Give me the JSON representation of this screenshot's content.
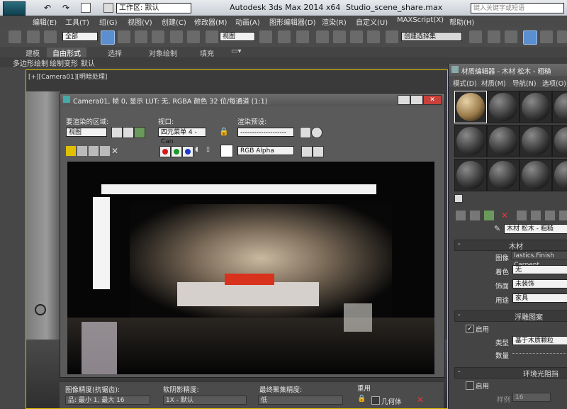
{
  "app": {
    "title": "Autodesk 3ds Max  2014 x64",
    "file": "Studio_scene_share.max",
    "workspace_label": "工作区: 默认",
    "search_placeholder": "键入关键字或短语"
  },
  "menu": [
    "编辑(E)",
    "工具(T)",
    "组(G)",
    "视图(V)",
    "创建(C)",
    "修改器(M)",
    "动画(A)",
    "图形编辑器(D)",
    "渲染(R)",
    "自定义(U)",
    "MAXScript(X)",
    "帮助(H)"
  ],
  "toolbar": {
    "selection_filter": "全部",
    "ref_coord": "视图",
    "named_selection": "创建选择集"
  },
  "ribbon": {
    "tabs": [
      "建模",
      "自由形式",
      "选择",
      "对象绘制",
      "填充"
    ],
    "active_tab": "自由形式",
    "sub_items": [
      "多边形绘制",
      "绘制变形",
      "默认"
    ]
  },
  "viewport": {
    "label": "[+][Camera01][明暗处理]"
  },
  "frame_window": {
    "title": "Camera01, 帧 0, 显示 LUT: 无, RGBA 颜色 32 位/每通道 (1:1)",
    "area_label": "要渲染的区域:",
    "area_value": "视图",
    "viewport_label": "视口:",
    "viewport_value": "四元菜单 4 - Can",
    "preset_label": "渲染预设:",
    "preset_value": "--------------------",
    "channel_value": "RGB Alpha",
    "colors": {
      "red": "#d21a1a",
      "green": "#1a9a2a",
      "blue": "#1a3ad2"
    },
    "bottom": {
      "image_precision_label": "图像精度(抗锯齿):",
      "image_precision_value": "品: 最小 1, 最大 16",
      "soft_shadow_label": "软阴影精度:",
      "soft_shadow_value": "1X - 默认",
      "fg_label": "最终聚集精度:",
      "fg_value": "低",
      "reuse_label": "重用",
      "geometry_label": "几何体"
    }
  },
  "material_editor": {
    "title": "材质编辑器 - 木材 松木 - 粗糙",
    "menu": [
      "模式(D)",
      "材质(M)",
      "导航(N)",
      "选项(O)"
    ],
    "material_name": "木材 松木 - 粗糙",
    "section_wood": "木材",
    "image_label": "图像",
    "image_value": "lastics.Finish Carpent",
    "stain_label": "着色",
    "stain_value": "无",
    "finish_label": "饰面",
    "finish_value": "未装饰",
    "use_label": "用途",
    "use_value": "家具",
    "section_relief": "浮雕图案",
    "enable_label": "启用",
    "type_label": "类型",
    "type_value": "基于木质颗粒",
    "amount_label": "数量",
    "section_ao": "环境光阻挡",
    "ao_enable_label": "启用",
    "samples_label": "样例",
    "samples_value": "16"
  }
}
